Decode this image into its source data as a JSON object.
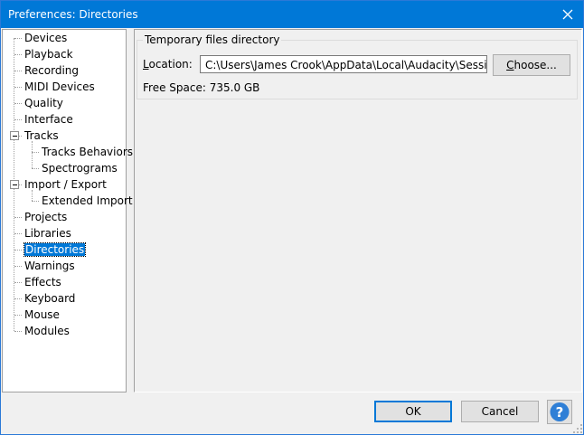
{
  "window": {
    "title": "Preferences: Directories"
  },
  "tree": {
    "items": [
      {
        "label": "Devices",
        "level": 0
      },
      {
        "label": "Playback",
        "level": 0
      },
      {
        "label": "Recording",
        "level": 0
      },
      {
        "label": "MIDI Devices",
        "level": 0
      },
      {
        "label": "Quality",
        "level": 0
      },
      {
        "label": "Interface",
        "level": 0
      },
      {
        "label": "Tracks",
        "level": 0,
        "expanded": true
      },
      {
        "label": "Tracks Behaviors",
        "level": 1
      },
      {
        "label": "Spectrograms",
        "level": 1
      },
      {
        "label": "Import / Export",
        "level": 0,
        "expanded": true
      },
      {
        "label": "Extended Import",
        "level": 1
      },
      {
        "label": "Projects",
        "level": 0
      },
      {
        "label": "Libraries",
        "level": 0
      },
      {
        "label": "Directories",
        "level": 0,
        "selected": true
      },
      {
        "label": "Warnings",
        "level": 0
      },
      {
        "label": "Effects",
        "level": 0
      },
      {
        "label": "Keyboard",
        "level": 0
      },
      {
        "label": "Mouse",
        "level": 0
      },
      {
        "label": "Modules",
        "level": 0
      }
    ]
  },
  "group": {
    "legend": "Temporary files directory",
    "location_label": "Location:",
    "location_value": "C:\\Users\\James Crook\\AppData\\Local\\Audacity\\SessionData",
    "choose_label": "Choose...",
    "free_space_label": "Free Space:",
    "free_space_value": "735.0 GB"
  },
  "buttons": {
    "ok": "OK",
    "cancel": "Cancel"
  },
  "colors": {
    "titlebar": "#0078d7",
    "selection": "#0078d7",
    "help_icon": "#2f7fd6"
  }
}
